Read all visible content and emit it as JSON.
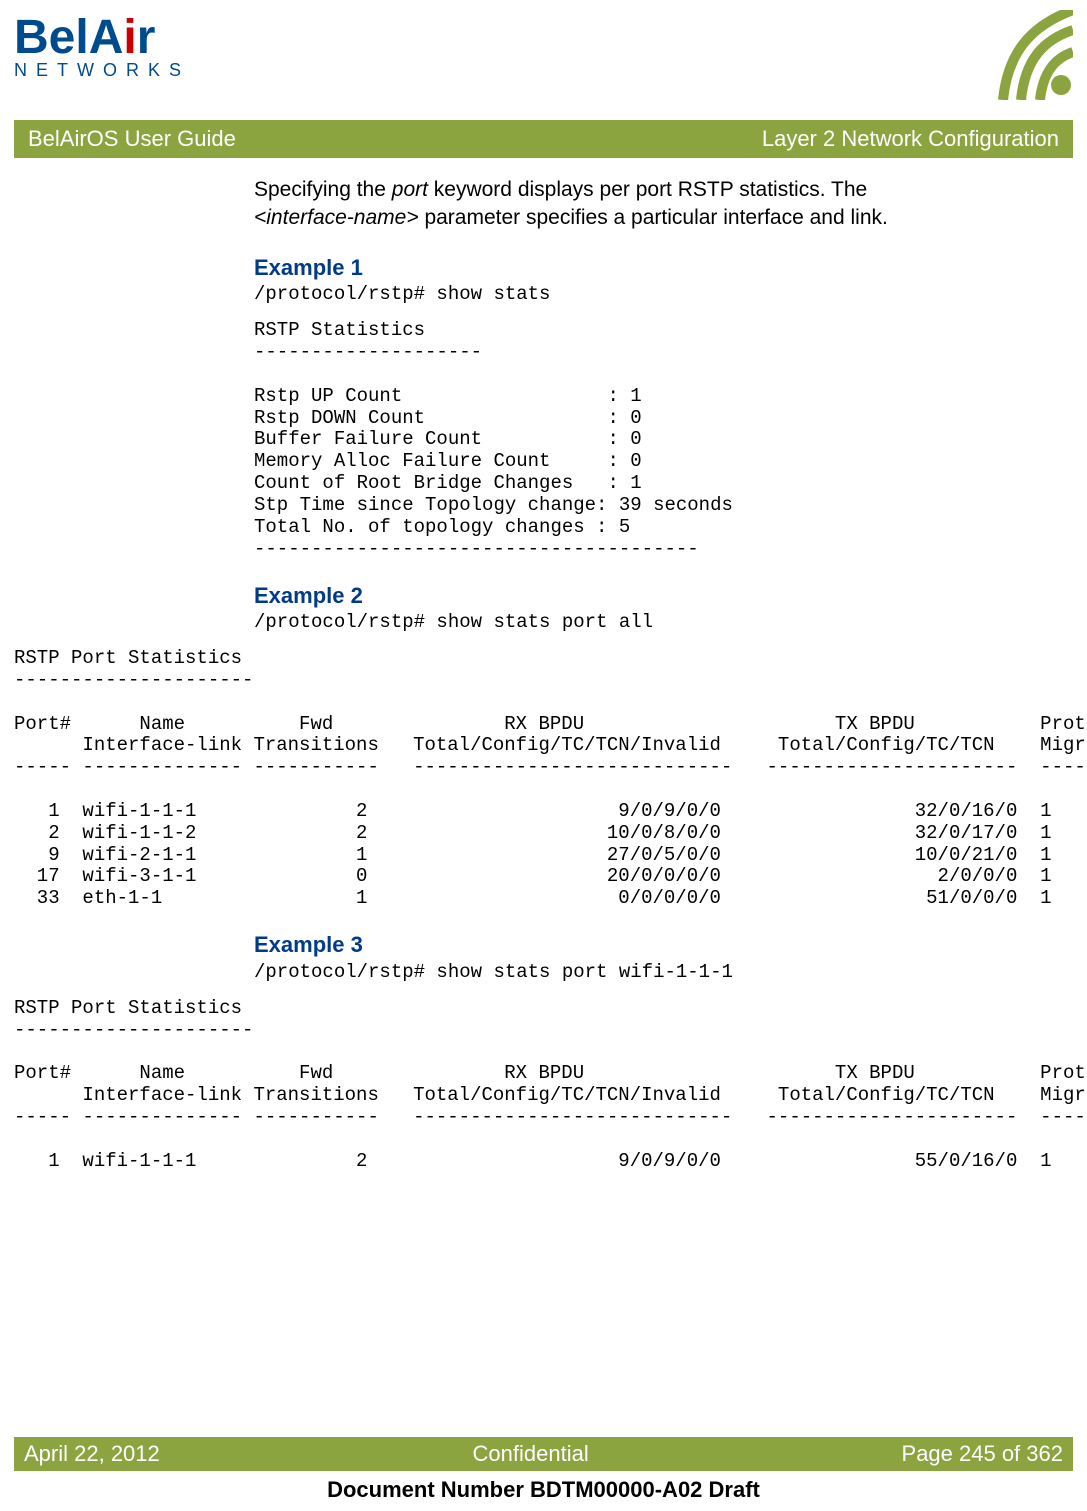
{
  "brand": {
    "name_part1": "BelA",
    "name_dot": "i",
    "name_part2": "r",
    "subtitle": "NETWORKS"
  },
  "titlebar": {
    "left": "BelAirOS User Guide",
    "right": "Layer 2 Network Configuration"
  },
  "intro": {
    "p1a": "Specifying the ",
    "p1b": "port",
    "p1c": " keyword displays per port RSTP statistics. The ",
    "p2a": "<interface-name>",
    "p2b": " parameter specifies a particular interface and link."
  },
  "ex1": {
    "heading": "Example 1",
    "cmd": "/protocol/rstp# show stats",
    "body": "RSTP Statistics\n--------------------\n\nRstp UP Count                  : 1\nRstp DOWN Count                : 0\nBuffer Failure Count           : 0\nMemory Alloc Failure Count     : 0\nCount of Root Bridge Changes   : 1\nStp Time since Topology change: 39 seconds\nTotal No. of topology changes : 5\n---------------------------------------"
  },
  "ex2": {
    "heading": "Example 2",
    "cmd": "/protocol/rstp# show stats port all",
    "body": "RSTP Port Statistics\n---------------------\n\nPort#      Name          Fwd               RX BPDU                      TX BPDU           Protocol\n      Interface-link Transitions   Total/Config/TC/TCN/Invalid     Total/Config/TC/TCN    Migration\n----- -------------- -----------   ----------------------------   ----------------------  ---------\n\n   1  wifi-1-1-1              2                      9/0/9/0/0                 32/0/16/0  1\n   2  wifi-1-1-2              2                     10/0/8/0/0                 32/0/17/0  1\n   9  wifi-2-1-1              1                     27/0/5/0/0                 10/0/21/0  1\n  17  wifi-3-1-1              0                     20/0/0/0/0                   2/0/0/0  1\n  33  eth-1-1                 1                      0/0/0/0/0                  51/0/0/0  1"
  },
  "ex3": {
    "heading": "Example 3",
    "cmd": "/protocol/rstp# show stats port wifi-1-1-1",
    "body": "RSTP Port Statistics\n---------------------\n\nPort#      Name          Fwd               RX BPDU                      TX BPDU           Protocol\n      Interface-link Transitions   Total/Config/TC/TCN/Invalid     Total/Config/TC/TCN    Migration\n----- -------------- -----------   ----------------------------   ----------------------  ---------\n\n   1  wifi-1-1-1              2                      9/0/9/0/0                 55/0/16/0  1"
  },
  "footer": {
    "date": "April 22, 2012",
    "center": "Confidential",
    "page": "Page 245 of 362",
    "docnum": "Document Number BDTM00000-A02 Draft"
  }
}
